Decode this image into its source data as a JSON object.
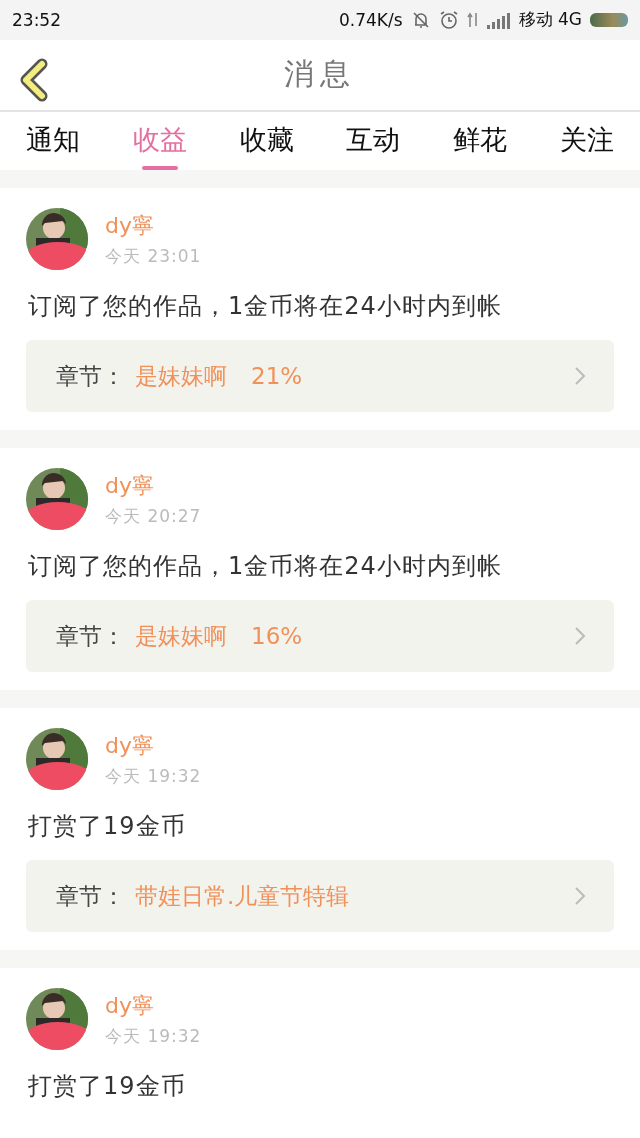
{
  "status_bar": {
    "time": "23:52",
    "speed": "0.74K/s",
    "carrier": "移动 4G"
  },
  "header": {
    "title": "消息"
  },
  "tabs": [
    {
      "label": "通知",
      "selected": false
    },
    {
      "label": "收益",
      "selected": true
    },
    {
      "label": "收藏",
      "selected": false
    },
    {
      "label": "互动",
      "selected": false
    },
    {
      "label": "鲜花",
      "selected": false
    },
    {
      "label": "关注",
      "selected": false
    }
  ],
  "messages": [
    {
      "user": "dy寧",
      "time": "今天 23:01",
      "text": "订阅了您的作品，1金币将在24小时内到帐",
      "chapter": {
        "label": "章节：",
        "title": "是妹妹啊",
        "extra": "21%"
      }
    },
    {
      "user": "dy寧",
      "time": "今天 20:27",
      "text": "订阅了您的作品，1金币将在24小时内到帐",
      "chapter": {
        "label": "章节：",
        "title": "是妹妹啊",
        "extra": "16%"
      }
    },
    {
      "user": "dy寧",
      "time": "今天 19:32",
      "text": "打赏了19金币",
      "chapter": {
        "label": "章节：",
        "title": "带娃日常.儿童节特辑"
      }
    },
    {
      "user": "dy寧",
      "time": "今天 19:32",
      "text": "打赏了19金币"
    }
  ]
}
